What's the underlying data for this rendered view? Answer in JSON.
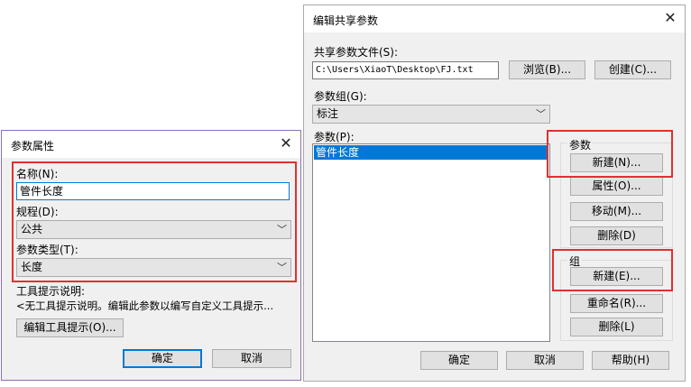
{
  "shared_dialog": {
    "title": "编辑共享参数",
    "file_label": "共享参数文件(S):",
    "file_path": "C:\\Users\\XiaoT\\Desktop\\FJ.txt",
    "browse_label": "浏览(B)...",
    "create_label": "创建(C)...",
    "group_label": "参数组(G):",
    "group_value": "标注",
    "params_label": "参数(P):",
    "params_items": [
      "管件长度"
    ],
    "params_section_title": "参数",
    "param_new_label": "新建(N)...",
    "param_props_label": "属性(O)...",
    "param_move_label": "移动(M)...",
    "param_delete_label": "删除(D)",
    "group_section_title": "组",
    "group_new_label": "新建(E)...",
    "group_rename_label": "重命名(R)...",
    "group_delete_label": "删除(L)",
    "ok_label": "确定",
    "cancel_label": "取消",
    "help_label": "帮助(H)"
  },
  "props_dialog": {
    "title": "参数属性",
    "name_label": "名称(N):",
    "name_value": "管件长度",
    "discipline_label": "规程(D):",
    "discipline_value": "公共",
    "type_label": "参数类型(T):",
    "type_value": "长度",
    "tooltip_label": "工具提示说明:",
    "tooltip_text": "<无工具提示说明。编辑此参数以编写自定义工具提示...",
    "edit_tooltip_label": "编辑工具提示(O)...",
    "ok_label": "确定",
    "cancel_label": "取消"
  },
  "icons": {
    "close": "close-icon",
    "dropdown": "chevron-down-icon"
  },
  "colors": {
    "highlight_box": "#e03030",
    "selection": "#0078d7",
    "props_border": "#8a6fb8"
  }
}
